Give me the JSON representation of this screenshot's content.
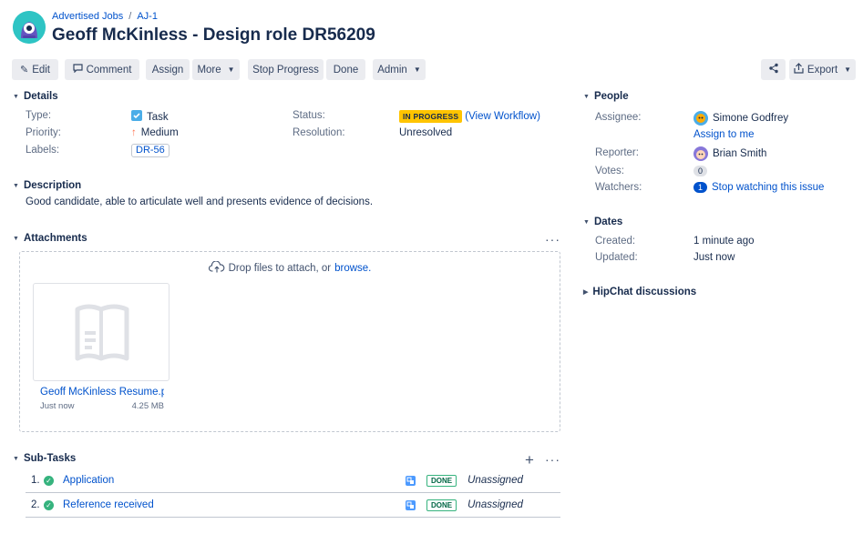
{
  "breadcrumb": {
    "project": "Advertised Jobs",
    "issue_key": "AJ-1"
  },
  "title": "Geoff McKinless - Design role DR56209",
  "toolbar": {
    "edit": "Edit",
    "comment": "Comment",
    "assign": "Assign",
    "more": "More",
    "stop_progress": "Stop Progress",
    "done": "Done",
    "admin": "Admin",
    "export": "Export"
  },
  "details": {
    "heading": "Details",
    "type_label": "Type:",
    "type_value": "Task",
    "priority_label": "Priority:",
    "priority_value": "Medium",
    "labels_label": "Labels:",
    "labels_value": "DR-56",
    "status_label": "Status:",
    "status_value": "IN PROGRESS",
    "view_workflow": "(View Workflow)",
    "resolution_label": "Resolution:",
    "resolution_value": "Unresolved"
  },
  "description": {
    "heading": "Description",
    "text": "Good candidate, able to articulate well and presents evidence of decisions."
  },
  "attachments": {
    "heading": "Attachments",
    "drop_text": "Drop files to attach, or",
    "browse": "browse.",
    "file_name": "Geoff McKinless Resume.p",
    "file_time": "Just now",
    "file_size": "4.25 MB"
  },
  "subtasks": {
    "heading": "Sub-Tasks",
    "items": [
      {
        "num": "1.",
        "name": "Application",
        "status": "DONE",
        "assignee": "Unassigned"
      },
      {
        "num": "2.",
        "name": "Reference received",
        "status": "DONE",
        "assignee": "Unassigned"
      }
    ]
  },
  "people": {
    "heading": "People",
    "assignee_label": "Assignee:",
    "assignee": "Simone Godfrey",
    "assign_to_me": "Assign to me",
    "reporter_label": "Reporter:",
    "reporter": "Brian Smith",
    "votes_label": "Votes:",
    "votes": "0",
    "watchers_label": "Watchers:",
    "watchers": "1",
    "stop_watching": "Stop watching this issue"
  },
  "dates": {
    "heading": "Dates",
    "created_label": "Created:",
    "created": "1 minute ago",
    "updated_label": "Updated:",
    "updated": "Just now"
  },
  "hipchat": {
    "heading": "HipChat discussions"
  },
  "icons": {
    "edit": "pencil-icon",
    "comment": "speech-bubble-icon",
    "share": "share-icon",
    "export": "export-icon",
    "upload": "cloud-upload-icon",
    "add": "plus-icon",
    "more": "ellipsis-icon"
  },
  "colors": {
    "link": "#0052cc",
    "in_progress": "#ffc400",
    "done": "#36b37e",
    "button_bg": "#ebecf0",
    "avatar_teal": "#2ec4c4"
  }
}
